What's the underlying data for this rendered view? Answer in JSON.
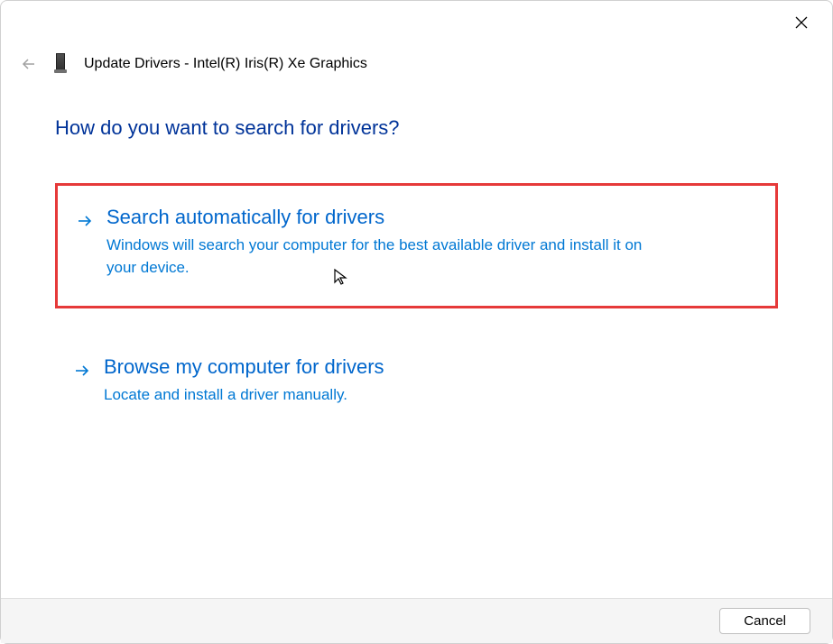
{
  "window": {
    "title": "Update Drivers - Intel(R) Iris(R) Xe Graphics"
  },
  "main": {
    "heading": "How do you want to search for drivers?"
  },
  "options": {
    "auto": {
      "title": "Search automatically for drivers",
      "desc": "Windows will search your computer for the best available driver and install it on your device."
    },
    "browse": {
      "title": "Browse my computer for drivers",
      "desc": "Locate and install a driver manually."
    }
  },
  "footer": {
    "cancel_label": "Cancel"
  }
}
